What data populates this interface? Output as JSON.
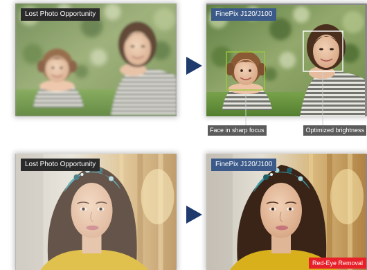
{
  "rows": [
    {
      "before_label": "Lost Photo Opportunity",
      "after_label": "FinePix J120/J100",
      "callouts": [
        "Face in sharp focus",
        "Optimized brightness"
      ]
    },
    {
      "before_label": "Lost Photo Opportunity",
      "after_label": "FinePix J120/J100",
      "badge": "Red-Eye Removal"
    }
  ],
  "icons": {
    "transition": "arrow-right-icon"
  },
  "colors": {
    "before_label_bg": "#2b2b2b",
    "after_label_bg": "#3b5a8a",
    "callout_bg": "#5b5b5b",
    "badge_bg": "#e8202a",
    "arrow": "#1f3a6c",
    "face_box_child": "#9cc83c",
    "face_box_adult": "#ffffff"
  }
}
